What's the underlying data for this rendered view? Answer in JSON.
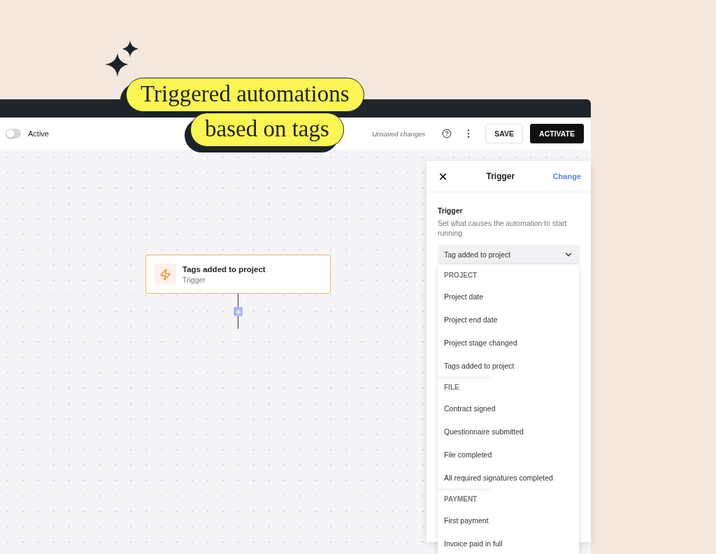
{
  "headline": {
    "lines": [
      "Triggered automations",
      "based on tags"
    ]
  },
  "toolbar": {
    "toggle": {
      "label": "Active",
      "on": false
    },
    "status": "Unsaved changes",
    "buttons": [
      {
        "label": "SAVE",
        "kind": "secondary"
      },
      {
        "label": "ACTIVATE",
        "kind": "primary"
      }
    ]
  },
  "canvas": {
    "node": {
      "title": "Tags added to project",
      "subtitle": "Trigger"
    }
  },
  "panel": {
    "title": "Trigger",
    "action": "Change",
    "field_label": "Trigger",
    "field_help": "Set what causes the automation to start running",
    "select": {
      "value": "Tag added to project"
    },
    "menu": [
      {
        "heading": "PROJECT",
        "items": [
          "Project date",
          "Project end date",
          "Project stage changed",
          "Tags added to project"
        ]
      },
      {
        "heading": "FILE",
        "items": [
          "Contract signed",
          "Questionnaire submitted",
          "File completed",
          "All required signatures completed"
        ]
      },
      {
        "heading": "PAYMENT",
        "items": [
          "First payment",
          "Invoice paid in full"
        ]
      }
    ]
  }
}
